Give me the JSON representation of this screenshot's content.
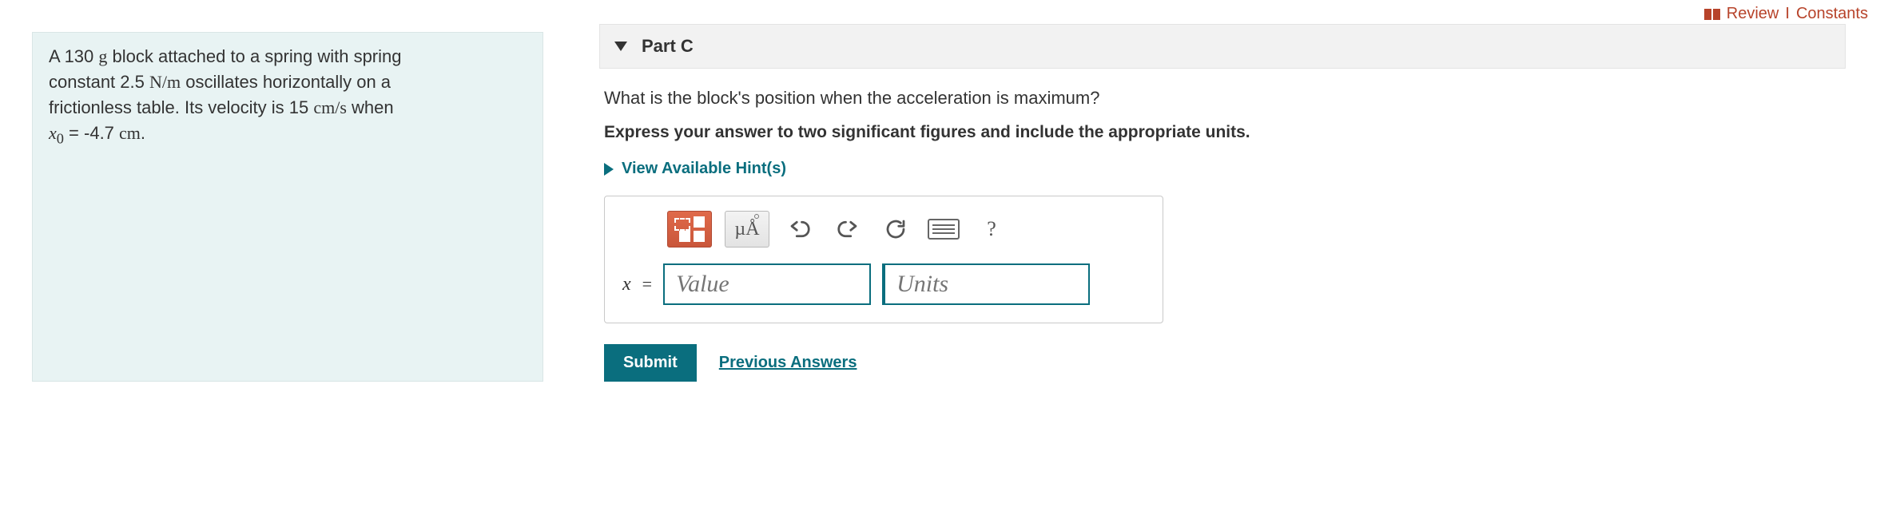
{
  "topLinks": {
    "review": "Review",
    "separator": "I",
    "constants": "Constants"
  },
  "problem": {
    "line1_a": "A 130 ",
    "line1_unit_g": "g",
    "line1_b": " block attached to a spring with spring",
    "line2_a": "constant 2.5 ",
    "line2_unit_nm": "N/m",
    "line2_b": " oscillates horizontally on a",
    "line3_a": "frictionless table. Its velocity is 15 ",
    "line3_unit_cms": "cm/s",
    "line3_b": " when",
    "line4_var": "x",
    "line4_sub": "0",
    "line4_eq": " = -4.7 ",
    "line4_unit_cm": "cm",
    "line4_end": "."
  },
  "part": {
    "label": "Part C",
    "question": "What is the block's position when the acceleration is maximum?",
    "instructions": "Express your answer to two significant figures and include the appropriate units.",
    "hints_label": "View Available Hint(s)",
    "toolbar": {
      "units_symbol": "µÅ",
      "help": "?"
    },
    "answer": {
      "var": "x",
      "eq": "=",
      "value_placeholder": "Value",
      "units_placeholder": "Units"
    },
    "submit_label": "Submit",
    "prev_answers_label": "Previous Answers"
  }
}
